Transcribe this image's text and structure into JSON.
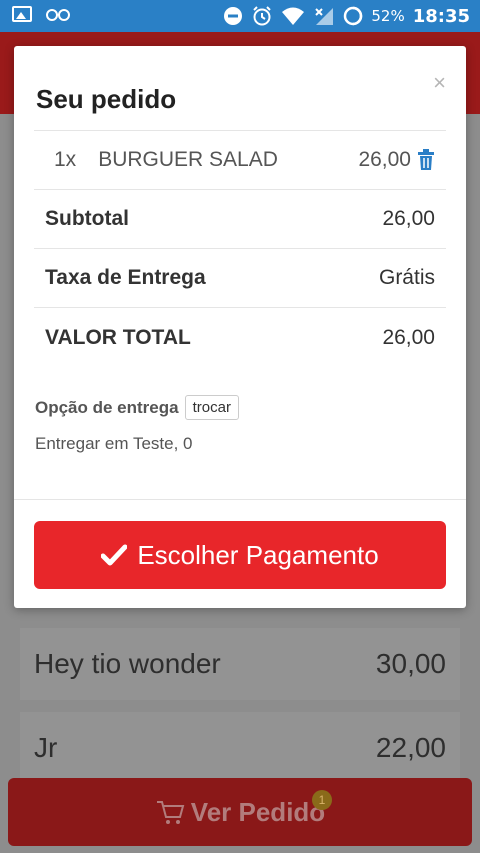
{
  "status_bar": {
    "battery_percent": "52%",
    "time": "18:35",
    "icons": [
      "image-icon",
      "voicemail-icon",
      "dnd-icon",
      "alarm-icon",
      "wifi-icon",
      "signal-icon",
      "battery-icon"
    ]
  },
  "modal": {
    "title": "Seu pedido",
    "close_label": "×",
    "item": {
      "qty": "1x",
      "name": "BURGUER SALAD",
      "price": "26,00"
    },
    "subtotal": {
      "label": "Subtotal",
      "value": "26,00"
    },
    "taxa": {
      "label": "Taxa de Entrega",
      "value": "Grátis"
    },
    "total": {
      "label": "VALOR TOTAL",
      "value": "26,00"
    },
    "delivery_option_label": "Opção de entrega",
    "trocar_label": "trocar",
    "delivery_address": "Entregar em Teste, 0",
    "pay_button_label": "Escolher Pagamento"
  },
  "background": {
    "items": [
      {
        "name": "Hey tio wonder",
        "price": "30,00"
      },
      {
        "name": "Jr",
        "price": "22,00"
      }
    ],
    "ver_pedido_label": "Ver Pedido",
    "cart_count": "1"
  },
  "colors": {
    "status_bar": "#2a80c6",
    "accent_red": "#e8262a",
    "trash_blue": "#2a7ec6"
  }
}
